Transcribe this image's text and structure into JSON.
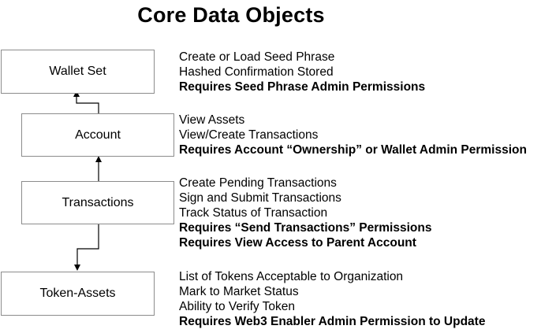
{
  "title": "Core Data Objects",
  "objects": [
    {
      "name": "Wallet Set",
      "lines": [
        "Create or Load Seed Phrase",
        "Hashed Confirmation Stored"
      ],
      "requirements": [
        "Requires Seed Phrase Admin Permissions"
      ]
    },
    {
      "name": "Account",
      "lines": [
        "View Assets",
        "View/Create Transactions"
      ],
      "requirements": [
        "Requires Account “Ownership” or Wallet Admin Permission"
      ]
    },
    {
      "name": "Transactions",
      "lines": [
        "Create Pending Transactions",
        "Sign and Submit Transactions",
        "Track Status of Transaction"
      ],
      "requirements": [
        "Requires “Send Transactions” Permissions",
        "Requires View Access to Parent Account"
      ]
    },
    {
      "name": "Token-Assets",
      "lines": [
        "List of Tokens Acceptable to Organization",
        "Mark to Market Status",
        "Ability to Verify Token"
      ],
      "requirements": [
        "Requires Web3 Enabler Admin Permission to Update"
      ]
    }
  ]
}
